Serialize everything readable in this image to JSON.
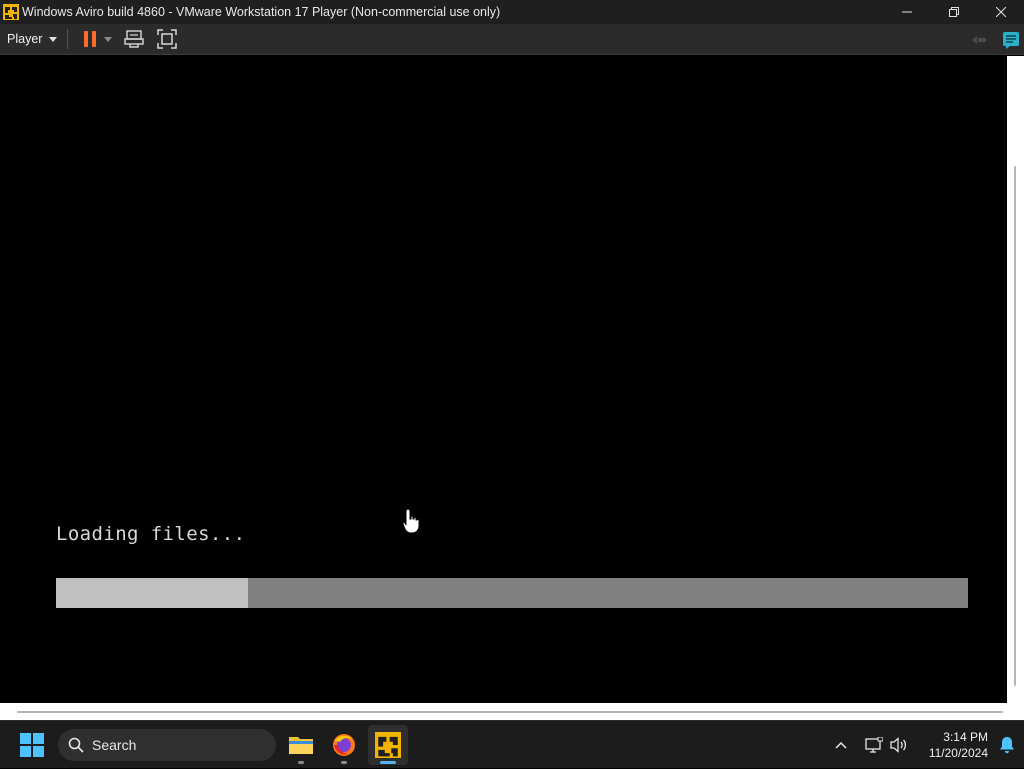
{
  "window": {
    "title": "Windows Aviro build 4860 - VMware Workstation 17 Player (Non-commercial use only)",
    "controls": {
      "minimize_icon": "minimize-icon",
      "restore_icon": "restore-icon",
      "close_icon": "close-icon"
    }
  },
  "toolbar": {
    "player_menu_label": "Player",
    "items": [
      "pause-icon",
      "send-ctrl-alt-del-icon",
      "full-screen-icon"
    ],
    "right_items": [
      "unity-icon",
      "message-log-icon"
    ],
    "accent_color": "#ff6d2e"
  },
  "vm": {
    "loading_text": "Loading files...",
    "progress_fraction": 0.21,
    "progress_colors": {
      "track": "#808080",
      "fill": "#c0c0c0"
    }
  },
  "taskbar": {
    "search_label": "Search",
    "apps": [
      {
        "name": "File Explorer",
        "icon": "folder-icon",
        "active": false
      },
      {
        "name": "Firefox",
        "icon": "firefox-icon",
        "active": false
      },
      {
        "name": "VMware Workstation Player",
        "icon": "vmware-icon",
        "active": true
      }
    ],
    "clock": {
      "time": "3:14 PM",
      "date": "11/20/2024"
    },
    "tray_icons": [
      "chevron-up-icon",
      "network-icon",
      "volume-icon",
      "notification-bell-icon"
    ],
    "accent_color": "#58b4f0"
  }
}
